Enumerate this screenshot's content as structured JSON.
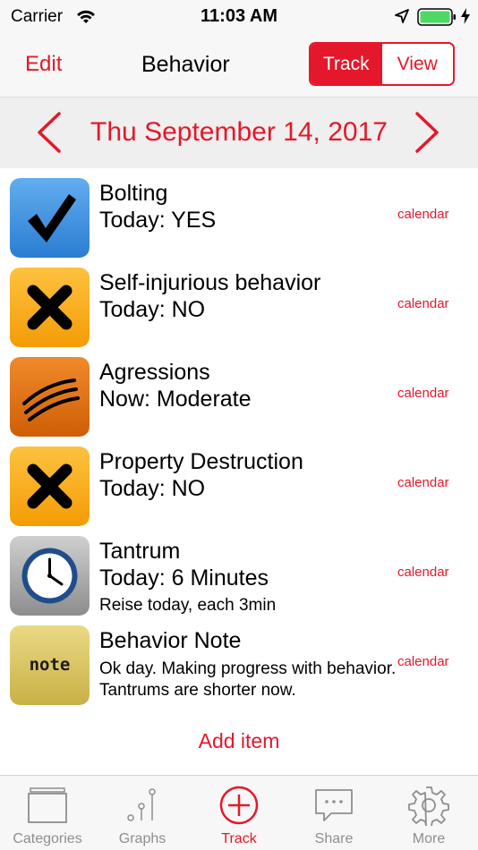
{
  "status_bar": {
    "carrier": "Carrier",
    "time": "11:03 AM"
  },
  "nav": {
    "edit_label": "Edit",
    "title": "Behavior",
    "segments": [
      "Track",
      "View"
    ],
    "active_segment": "Track"
  },
  "date_bar": {
    "date": "Thu September 14, 2017"
  },
  "items": [
    {
      "title": "Bolting",
      "value": "Today: YES",
      "note": "",
      "calendar": "calendar",
      "icon": "check-icon"
    },
    {
      "title": "Self-injurious behavior",
      "value": "Today: NO",
      "note": "",
      "calendar": "calendar",
      "icon": "x-icon"
    },
    {
      "title": "Agressions",
      "value": "Now: Moderate",
      "note": "",
      "calendar": "calendar",
      "icon": "scale-icon"
    },
    {
      "title": "Property Destruction",
      "value": "Today: NO",
      "note": "",
      "calendar": "calendar",
      "icon": "x-icon"
    },
    {
      "title": "Tantrum",
      "value": "Today: 6 Minutes",
      "note": "Reise today, each 3min",
      "calendar": "calendar",
      "icon": "clock-icon"
    },
    {
      "title": "Behavior Note",
      "value": "",
      "note": "Ok day. Making progress with behavior. Tantrums are shorter now.",
      "calendar": "calendar",
      "icon": "note-icon",
      "icon_text": "note"
    }
  ],
  "add_item_label": "Add item",
  "tabs": [
    {
      "label": "Categories",
      "icon": "categories-icon"
    },
    {
      "label": "Graphs",
      "icon": "graphs-icon"
    },
    {
      "label": "Track",
      "icon": "add-circle-icon",
      "active": true
    },
    {
      "label": "Share",
      "icon": "share-icon"
    },
    {
      "label": "More",
      "icon": "gear-icon"
    }
  ],
  "colors": {
    "accent": "#e4182a",
    "check_icon_bg": "#3d8fde",
    "x_icon_bg": "#f8a50f",
    "scale_icon_bg": "#e0710b",
    "clock_icon_bg": "#a4a4a4",
    "note_icon_bg": "#d9c35e"
  }
}
